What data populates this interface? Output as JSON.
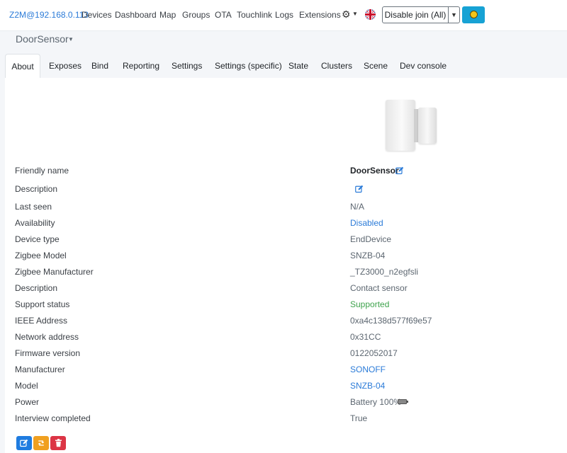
{
  "navbar": {
    "brand": "Z2M@192.168.0.113",
    "links": [
      "Devices",
      "Dashboard",
      "Map",
      "Groups",
      "OTA",
      "Touchlink",
      "Logs",
      "Extensions"
    ],
    "join_button": "Disable join (All)"
  },
  "device": {
    "name": "DoorSensor"
  },
  "tabs": [
    "About",
    "Exposes",
    "Bind",
    "Reporting",
    "Settings",
    "Settings (specific)",
    "State",
    "Clusters",
    "Scene",
    "Dev console"
  ],
  "about": {
    "rows": [
      {
        "label": "Friendly name",
        "value": "DoorSensor"
      },
      {
        "label": "Description",
        "value": ""
      },
      {
        "label": "Last seen",
        "value": "N/A"
      },
      {
        "label": "Availability",
        "value": "Disabled"
      },
      {
        "label": "Device type",
        "value": "EndDevice"
      },
      {
        "label": "Zigbee Model",
        "value": "SNZB-04"
      },
      {
        "label": "Zigbee Manufacturer",
        "value": "_TZ3000_n2egfsli"
      },
      {
        "label": "Description",
        "value": "Contact sensor"
      },
      {
        "label": "Support status",
        "value": "Supported"
      },
      {
        "label": "IEEE Address",
        "value": "0xa4c138d577f69e57"
      },
      {
        "label": "Network address",
        "value": "0x31CC"
      },
      {
        "label": "Firmware version",
        "value": "0122052017"
      },
      {
        "label": "Manufacturer",
        "value": "SONOFF"
      },
      {
        "label": "Model",
        "value": "SNZB-04"
      },
      {
        "label": "Power",
        "value": "Battery 100%"
      },
      {
        "label": "Interview completed",
        "value": "True"
      }
    ]
  },
  "colors": {
    "link": "#2b7bd8",
    "supported": "#3fa34d",
    "theme_button": "#17a2d4",
    "edit_button": "#1f7ce0",
    "reconfigure_button": "#f0a020",
    "remove_button": "#dc3545"
  },
  "icons": {
    "settings": "gear-icon",
    "language": "uk-flag-icon",
    "theme": "sun-icon",
    "edit": "pencil-square-icon",
    "power": "battery-icon",
    "reconfigure": "retweet-icon",
    "remove": "trash-icon"
  }
}
